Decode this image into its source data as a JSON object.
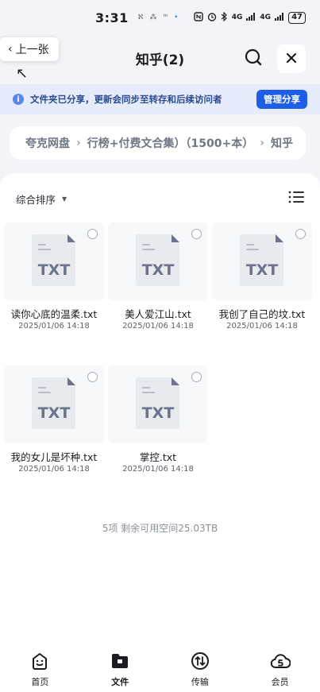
{
  "status_bar": {
    "time": "3:31",
    "notif_glyphs": [
      "ℵ",
      "⁂",
      "ᵐ",
      "•"
    ],
    "network_1": "4G",
    "network_2": "4G",
    "battery": "47"
  },
  "header": {
    "prev_label": "上一张",
    "title": "知乎(2)"
  },
  "notice": {
    "text": "文件夹已分享，更新会同步至转存和后续访问者",
    "button": "管理分享"
  },
  "breadcrumb": [
    "夸克网盘",
    "行榜+付费文合集）（1500+本）",
    "知乎"
  ],
  "sort": {
    "label": "综合排序"
  },
  "files": [
    {
      "name": "读你心底的温柔.txt",
      "date": "2025/01/06 14:18",
      "type": "TXT"
    },
    {
      "name": "美人爱江山.txt",
      "date": "2025/01/06 14:18",
      "type": "TXT"
    },
    {
      "name": "我创了自己的坟.txt",
      "date": "2025/01/06 14:18",
      "type": "TXT"
    },
    {
      "name": "我的女儿是坏种.txt",
      "date": "2025/01/06 14:18",
      "type": "TXT"
    },
    {
      "name": "掌控.txt",
      "date": "2025/01/06 14:18",
      "type": "TXT"
    }
  ],
  "footer_info": "5项 剩余可用空间25.03TB",
  "nav": [
    {
      "label": "首页",
      "icon": "home-face-icon"
    },
    {
      "label": "文件",
      "icon": "folder-icon"
    },
    {
      "label": "传输",
      "icon": "transfer-icon"
    },
    {
      "label": "会员",
      "icon": "member-cloud-icon"
    }
  ],
  "colors": {
    "accent": "#1e5de8",
    "notice_bg": "#e6ecfb",
    "page_bg": "#f3f4f7"
  }
}
